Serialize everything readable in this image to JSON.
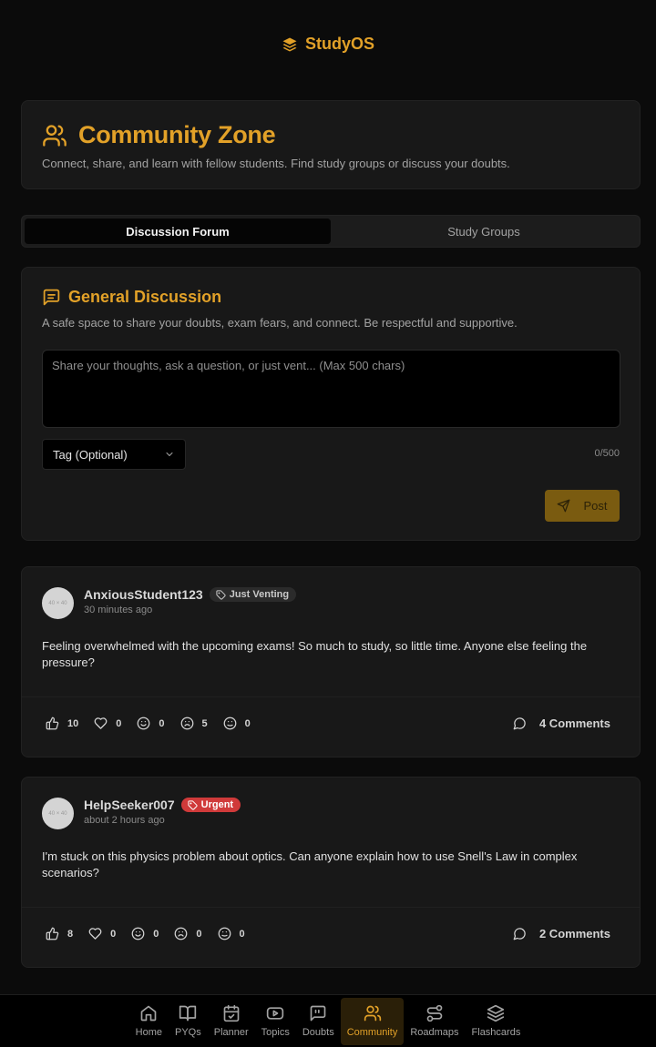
{
  "app": {
    "name": "StudyOS"
  },
  "header": {
    "title": "Community Zone",
    "subtitle": "Connect, share, and learn with fellow students. Find study groups or discuss your doubts."
  },
  "tabs": [
    {
      "label": "Discussion Forum",
      "active": true
    },
    {
      "label": "Study Groups",
      "active": false
    }
  ],
  "discussion": {
    "title": "General Discussion",
    "subtitle": "A safe space to share your doubts, exam fears, and connect. Be respectful and supportive.",
    "placeholder": "Share your thoughts, ask a question, or just vent... (Max 500 chars)",
    "tag_select": "Tag (Optional)",
    "char_count": "0/500",
    "post_button": "Post"
  },
  "posts": [
    {
      "avatar_text": "40 × 40",
      "username": "AnxiousStudent123",
      "tag": "Just Venting",
      "time": "30 minutes ago",
      "body": "Feeling overwhelmed with the upcoming exams! So much to study, so little time. Anyone else feeling the pressure?",
      "likes": "10",
      "hearts": "0",
      "smiles": "0",
      "sad": "5",
      "neutral": "0",
      "comments": "4 Comments"
    },
    {
      "avatar_text": "40 × 40",
      "username": "HelpSeeker007",
      "tag": "Urgent",
      "time": "about 2 hours ago",
      "body": "I'm stuck on this physics problem about optics. Can anyone explain how to use Snell's Law in complex scenarios?",
      "likes": "8",
      "hearts": "0",
      "smiles": "0",
      "sad": "0",
      "neutral": "0",
      "comments": "2 Comments"
    }
  ],
  "nav": [
    {
      "label": "Home",
      "icon": "home-icon"
    },
    {
      "label": "PYQs",
      "icon": "book-open-icon"
    },
    {
      "label": "Planner",
      "icon": "calendar-check-icon"
    },
    {
      "label": "Topics",
      "icon": "youtube-icon"
    },
    {
      "label": "Doubts",
      "icon": "message-quote-icon"
    },
    {
      "label": "Community",
      "icon": "users-icon",
      "active": true
    },
    {
      "label": "Roadmaps",
      "icon": "route-icon"
    },
    {
      "label": "Flashcards",
      "icon": "layers-icon"
    }
  ],
  "colors": {
    "accent": "#e2a128",
    "background": "#0b0b0b",
    "card": "#181818",
    "urgent": "#d03a3a"
  }
}
